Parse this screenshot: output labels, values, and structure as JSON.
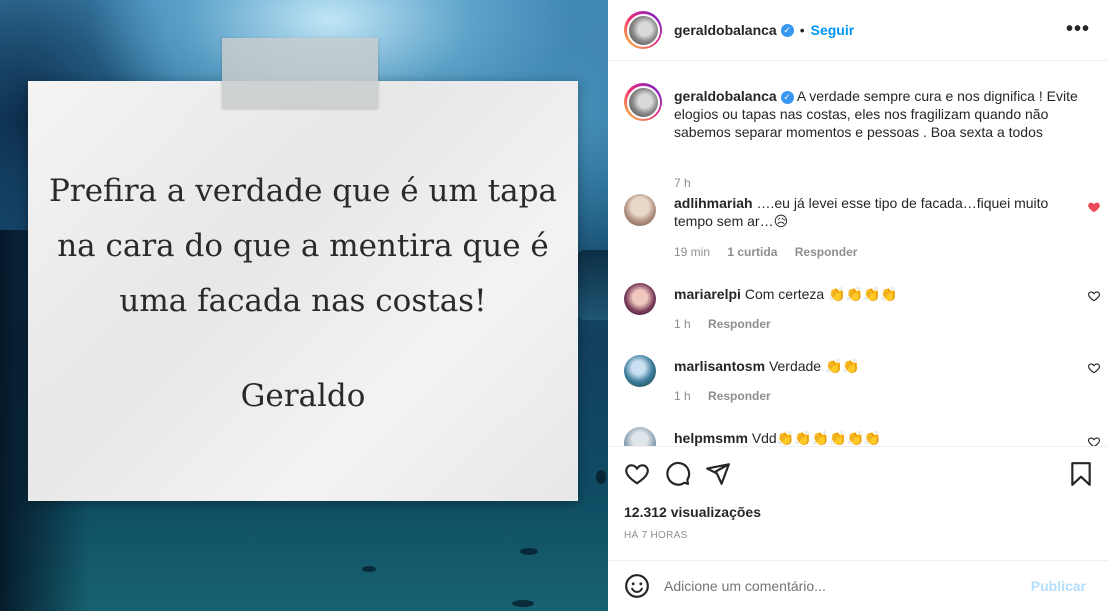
{
  "media": {
    "quote": "Prefira a verdade que é um tapa na cara do que a mentira que é uma facada nas costas!",
    "signature": "Geraldo"
  },
  "header": {
    "username": "geraldobalanca",
    "separator": "•",
    "follow_label": "Seguir",
    "more_label": "•••"
  },
  "caption": {
    "username": "geraldobalanca",
    "text": "A verdade sempre cura e nos dignifica ! Evite elogios ou tapas nas costas, eles nos fragilizam quando não sabemos separar momentos e pessoas . Boa sexta a todos",
    "time": "7 h"
  },
  "comments": [
    {
      "username": "adlihmariah",
      "text": "….eu já levei esse tipo de facada…fiquei muito tempo sem ar…😥",
      "time": "19 min",
      "likes": "1 curtida",
      "reply": "Responder",
      "liked": true
    },
    {
      "username": "mariarelpi",
      "text": "Com certeza 👏👏👏👏",
      "time": "1 h",
      "reply": "Responder",
      "liked": false
    },
    {
      "username": "marlisantosm",
      "text": "Verdade 👏👏",
      "time": "1 h",
      "reply": "Responder",
      "liked": false
    },
    {
      "username": "helpmsmm",
      "text": "Vdd👏👏👏👏👏👏",
      "time": "",
      "reply": "",
      "liked": false
    }
  ],
  "stats": {
    "views": "12.312 visualizações",
    "posted_ago": "HÁ 7 HORAS"
  },
  "add_comment": {
    "placeholder": "Adicione um comentário...",
    "publish_label": "Publicar"
  },
  "icons": [
    "heart-icon",
    "comment-icon",
    "share-icon",
    "bookmark-icon",
    "emoji-icon",
    "verified-icon",
    "more-icon"
  ],
  "colors": {
    "link": "#0095f6",
    "liked": "#ed4956",
    "muted": "#8e8e8e",
    "publish_disabled": "#b2dffc"
  }
}
